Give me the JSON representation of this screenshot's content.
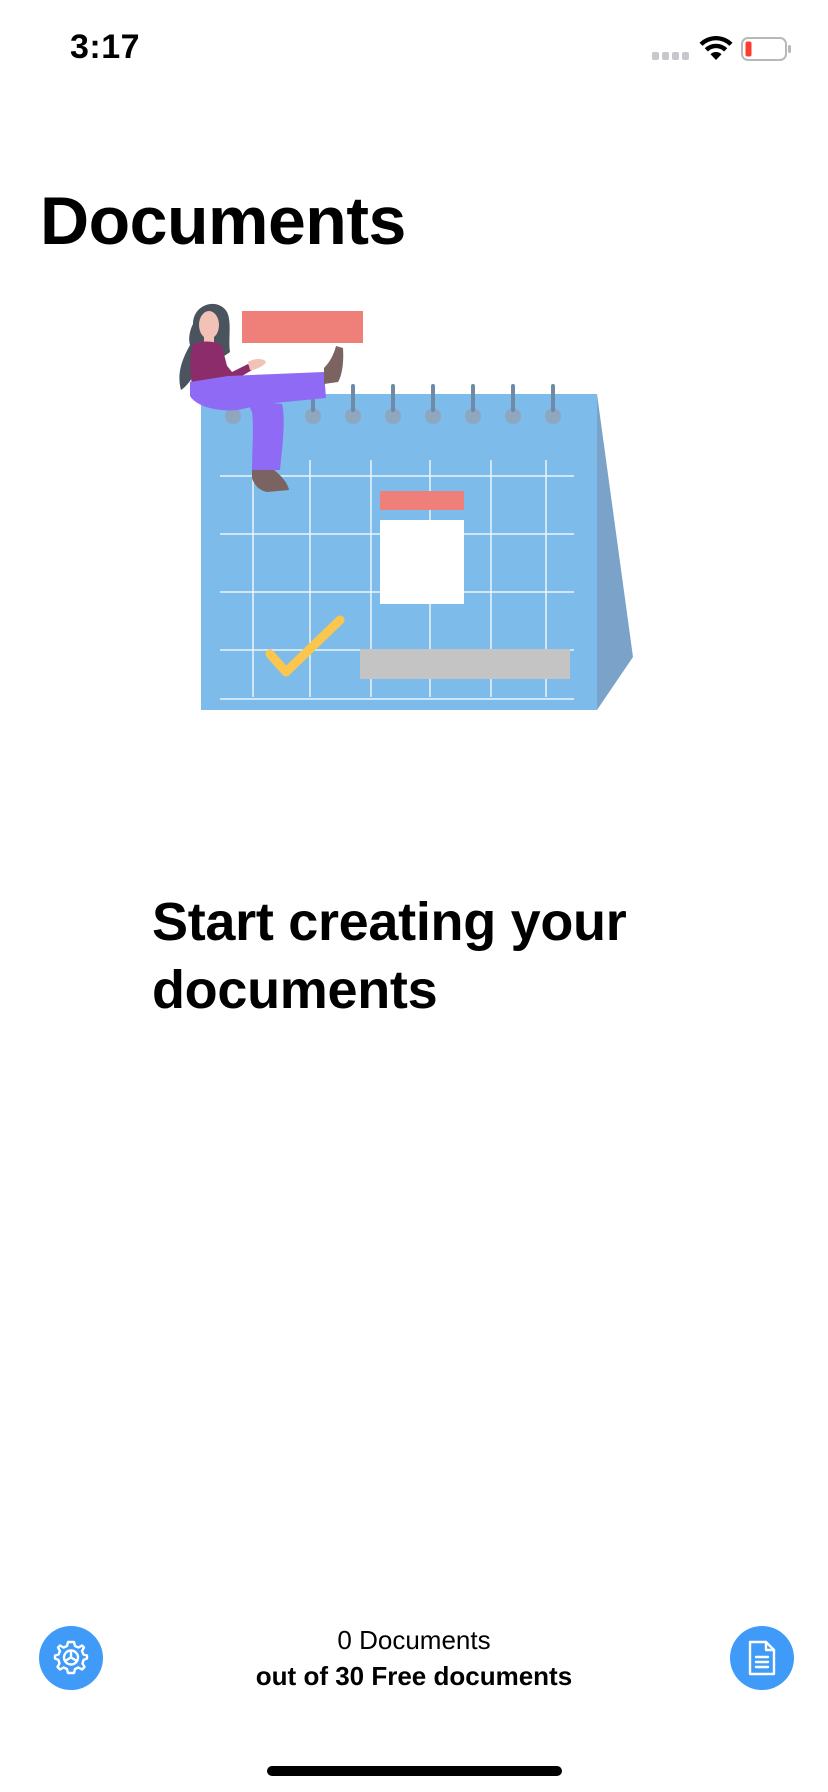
{
  "status_bar": {
    "time": "3:17"
  },
  "header": {
    "title": "Documents"
  },
  "empty_state": {
    "heading": "Start creating your documents",
    "illustration": "calendar-woman-illustration"
  },
  "footer": {
    "count_line": "0 Documents",
    "limit_line": "out of 30 Free documents",
    "settings_icon": "gear-icon",
    "new_document_icon": "document-icon"
  },
  "colors": {
    "accent": "#3f9bf7",
    "calendar": "#7dbbea",
    "calendar_side": "#7ba3c9",
    "highlight_red": "#ef7f79",
    "check_yellow": "#fbc64d",
    "pants_purple": "#8f6af5",
    "shirt_magenta": "#8c2c6b",
    "battery_low": "#ff3b30"
  }
}
